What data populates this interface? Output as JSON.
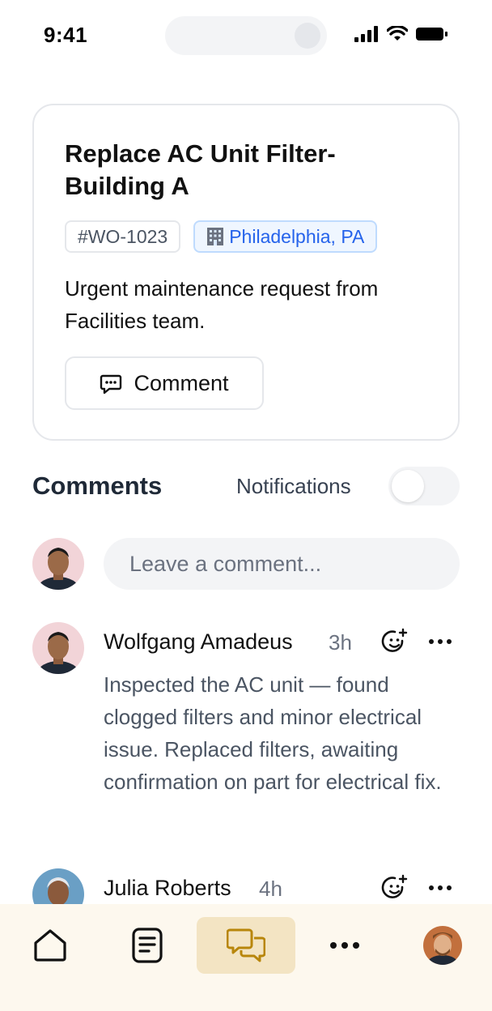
{
  "status_bar": {
    "time": "9:41"
  },
  "work_order": {
    "title": "Replace AC Unit Filter-Building A",
    "id_tag": "#WO-1023",
    "location_tag": "Philadelphia, PA",
    "description": "Urgent maintenance request from Facilities team.",
    "comment_button_label": "Comment"
  },
  "comments_section": {
    "heading": "Comments",
    "notifications_label": "Notifications",
    "notifications_on": false,
    "input_placeholder": "Leave a comment..."
  },
  "comments": [
    {
      "author": "Wolfgang Amadeus",
      "time": "3h",
      "body": "Inspected the AC unit — found clogged filters and minor electrical issue. Replaced filters, awaiting confirmation on part for electrical fix."
    },
    {
      "author": "Julia Roberts",
      "time": "4h",
      "body": ""
    }
  ],
  "nav": {
    "items": [
      "home-icon",
      "document-icon",
      "chat-icon",
      "more-icon",
      "profile-avatar"
    ],
    "active": "chat-icon",
    "active_color": "#f3e4c3",
    "bar_color": "#fdf8ee"
  },
  "colors": {
    "location_tag_text": "#2563eb",
    "location_tag_bg": "#eff6ff"
  }
}
